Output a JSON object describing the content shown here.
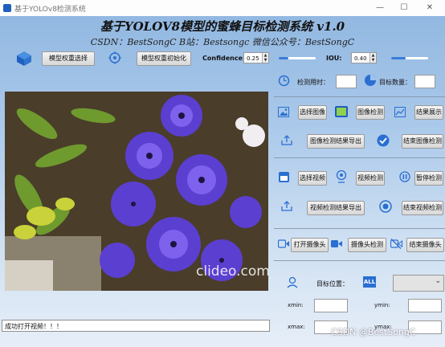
{
  "window": {
    "title": "基于YOLOv8检测系统"
  },
  "header": {
    "title": "基于YOLOV8模型的蜜蜂目标检测系统 v1.0",
    "subtitle": "CSDN：BestSongC   B站：Bestsongc   微信公众号：BestSongC"
  },
  "toolbar": {
    "weight_select_label": "模型权重选择",
    "weight_init_label": "模型权重初始化",
    "confidence_label": "Confidence:",
    "confidence_value": "0.25",
    "confidence_level": 0.25,
    "iou_label": "IOU:",
    "iou_value": "0.40",
    "iou_level": 0.4
  },
  "stats": {
    "time_label": "检测用时：",
    "time_value": "",
    "count_label": "目标数量：",
    "count_value": ""
  },
  "image_section": {
    "select_label": "选择图像",
    "detect_label": "图像检测",
    "show_label": "结果展示",
    "export_label": "图像检测结果导出",
    "end_label": "结束图像检测"
  },
  "video_section": {
    "select_label": "选择视频",
    "detect_label": "视频检测",
    "pause_label": "暂停检测",
    "export_label": "视频检测结果导出",
    "end_label": "结束视频检测"
  },
  "camera_section": {
    "open_label": "打开摄像头",
    "detect_label": "摄像头检测",
    "end_label": "结束摄像头"
  },
  "target": {
    "position_label": "目标位置：",
    "all_label": "ALL",
    "selected": "",
    "xmin_label": "xmin:",
    "ymin_label": "ymin:",
    "xmax_label": "xmax:",
    "ymax_label": "ymax:",
    "xmin": "",
    "ymin": "",
    "xmax": "",
    "ymax": ""
  },
  "image_view": {
    "watermark": "clideo.com"
  },
  "status": {
    "message": "成功打开视频！！！"
  },
  "footer": {
    "credit": "CSDN @BestSongC"
  },
  "colors": {
    "accent": "#2a6fd1",
    "panel_line": "#7a8ea6"
  }
}
